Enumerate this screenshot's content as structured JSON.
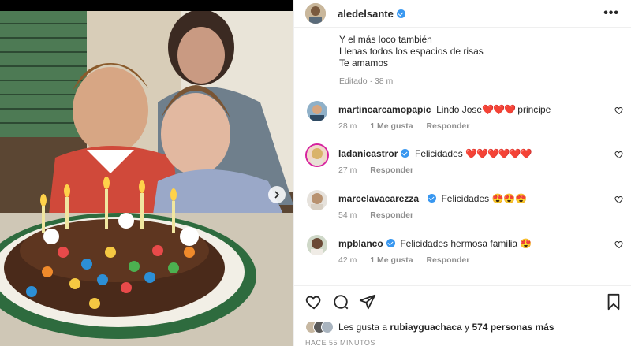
{
  "post": {
    "username": "aledelsante",
    "caption_lines": [
      "Y el más loco también",
      "Llenas todos los espacios de risas",
      "Te amamos"
    ],
    "caption_meta": "Editado · 38 m"
  },
  "comments": [
    {
      "username": "martincarcamopapic",
      "text_pre": "Lindo Jose",
      "hearts": "❤️❤️❤️",
      "text_post": " principe",
      "time": "28 m",
      "likes": "1 Me gusta",
      "reply": "Responder",
      "verified": false
    },
    {
      "username": "ladanicastror",
      "text_pre": "Felicidades ",
      "hearts": "❤️❤️❤️❤️❤️❤️",
      "text_post": "",
      "time": "27 m",
      "likes": "",
      "reply": "Responder",
      "verified": true
    },
    {
      "username": "marcelavacarezza_",
      "text_pre": "Felicidades ",
      "hearts": "😍😍😍",
      "text_post": "",
      "time": "54 m",
      "likes": "",
      "reply": "Responder",
      "verified": true
    },
    {
      "username": "mpblanco",
      "text_pre": "Felicidades hermosa familia ",
      "hearts": "😍",
      "text_post": "",
      "time": "42 m",
      "likes": "1 Me gusta",
      "reply": "Responder",
      "verified": true
    }
  ],
  "likes": {
    "prefix": "Les gusta a ",
    "user": "rubiayguachaca",
    "middle": " y ",
    "count": "574 personas más"
  },
  "timestamp": "HACE 55 MINUTOS",
  "icons": [
    "more-icon",
    "heart-icon",
    "comment-icon",
    "share-icon",
    "bookmark-icon",
    "chevron-right-icon",
    "verified-icon"
  ]
}
